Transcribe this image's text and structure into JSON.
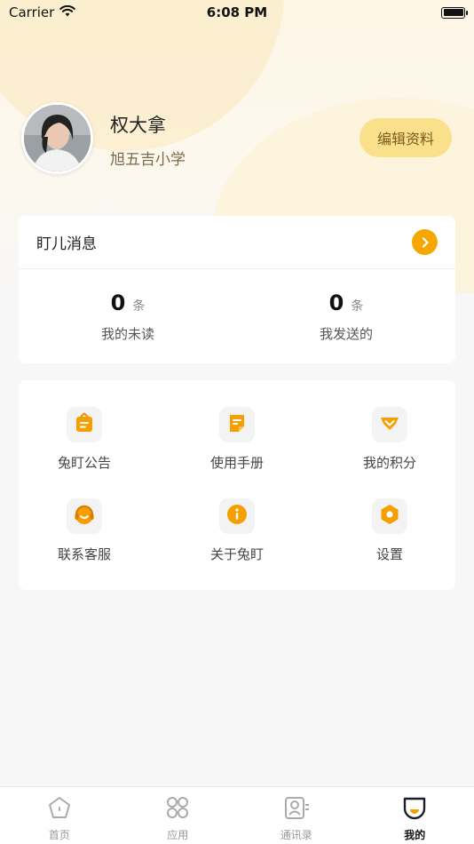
{
  "status_bar": {
    "carrier": "Carrier",
    "time": "6:08 PM"
  },
  "profile": {
    "name": "权大拿",
    "school": "旭五吉小学",
    "edit_label": "编辑资料"
  },
  "messages": {
    "title": "盯儿消息",
    "stats": [
      {
        "value": "0",
        "unit": "条",
        "label": "我的未读"
      },
      {
        "value": "0",
        "unit": "条",
        "label": "我发送的"
      }
    ]
  },
  "features": [
    {
      "label": "兔盯公告",
      "icon": "announcement-icon"
    },
    {
      "label": "使用手册",
      "icon": "manual-icon"
    },
    {
      "label": "我的积分",
      "icon": "points-icon"
    },
    {
      "label": "联系客服",
      "icon": "headset-icon"
    },
    {
      "label": "关于兔盯",
      "icon": "info-icon"
    },
    {
      "label": "设置",
      "icon": "settings-icon"
    }
  ],
  "tabbar": [
    {
      "label": "首页",
      "icon": "home-icon",
      "active": false
    },
    {
      "label": "应用",
      "icon": "apps-icon",
      "active": false
    },
    {
      "label": "通讯录",
      "icon": "contacts-icon",
      "active": false
    },
    {
      "label": "我的",
      "icon": "profile-icon",
      "active": true
    }
  ],
  "colors": {
    "accent": "#f6a800",
    "edit_button_bg": "#fbe08c",
    "page_bg": "#f7f7f7"
  }
}
